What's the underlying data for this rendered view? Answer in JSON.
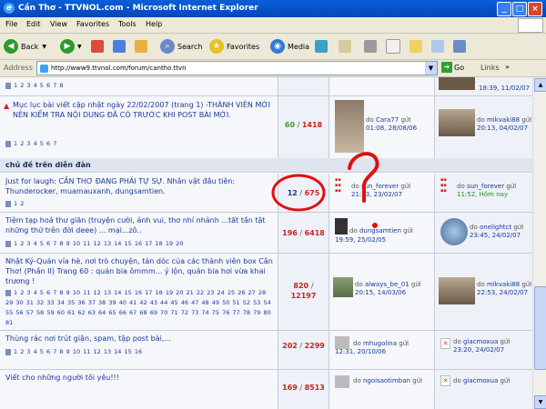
{
  "window": {
    "title": "Cần Thơ - TTVNOL.com - Microsoft Internet Explorer"
  },
  "menu": [
    "File",
    "Edit",
    "View",
    "Favorites",
    "Tools",
    "Help"
  ],
  "toolbar": {
    "back": "Back",
    "search": "Search",
    "favorites": "Favorites",
    "media": "Media"
  },
  "address": {
    "label": "Address",
    "url": "http://www9.ttvnol.com/forum/cantho.ttvn",
    "go": "Go",
    "links": "Links"
  },
  "rows_top": [
    {
      "pages": "1 2 3 4 5 6 7 8",
      "poster_time": "18:39, 11/02/07"
    },
    {
      "title": "Mục lục bài viết cập nhật ngày 22/02/2007 (trang 1) -THÀNH VIÊN MỚI NÊN KIỂM TRA NỘI DUNG ĐÃ CÓ TRƯỚC KHI POST BÀI MỚI.",
      "pages": "1 2 3 4 5 6 7",
      "replies": "60",
      "views": "1418",
      "first_by": "do",
      "first_user": "Cara77",
      "first_suffix": "gửi",
      "first_time": "01:08, 28/08/06",
      "last_by": "do",
      "last_user": "mikvaki88",
      "last_suffix": "gửi",
      "last_time": "20:13, 04/02/07"
    }
  ],
  "section": {
    "title": "chủ đề trên diễn đàn"
  },
  "rows": [
    {
      "title": "Just for laugh: CẦN THƠ ĐANG PHẢI TỰ SỰ. Nhân vật đầu tiên: Thunderocker, muamauxanh, dungsamtien.",
      "pages": "1 2",
      "replies": "12",
      "views": "675",
      "first_by": "do",
      "first_user": "sun_forever",
      "first_suffix": "gửi",
      "first_time": "21:53, 23/02/07",
      "last_by": "do",
      "last_user": "sun_forever",
      "last_suffix": "gửi",
      "last_time": "11:52, Hôm nay"
    },
    {
      "title": "Tiệm tạp hoá thư giãn (truyện cười, ảnh vui, thơ nhí nhảnh ...tất tần tật những thứ trên đời deee) ... mại...zô..",
      "pages": "1 2 3 4 5 6 7 8 9 10 11 12 13 14 15 16 17 18 19 20",
      "replies": "196",
      "views": "6418",
      "first_by": "do",
      "first_user": "dungsamtien",
      "first_suffix": "gửi",
      "first_time": "19:59, 25/02/05",
      "last_by": "do",
      "last_user": "onelightct",
      "last_suffix": "gửi",
      "last_time": "23:45, 24/02/07"
    },
    {
      "title": "Nhật Ký-Quán vỉa hè, nơi trò chuyện, tán dóc của các thành viên box Cần Thơ! (Phần II) Trang 60 : quán bia ômmm... ý lộn, quán bia hơi vừa khai trương !",
      "pages": "1 2 3 4 5 6 7 8 9 10 11 12 13 14 15 16 17 18 19 20 21 22 23 24 25 26 27 28 29 30 31 32 33 34 35 36 37 38 39 40 41 42 43 44 45 46 47 48 49 50 51 52 53 54 55 56 57 58 59 60 61 62 63 64 65 66 67 68 69 70 71 72 73 74 75 76 77 78 79 80 81",
      "replies": "820",
      "views": "12197",
      "first_by": "do",
      "first_user": "always_be_01",
      "first_suffix": "gửi",
      "first_time": "20:15, 14/03/06",
      "last_by": "do",
      "last_user": "mikvaki88",
      "last_suffix": "gửi",
      "last_time": "22:53, 24/02/07"
    },
    {
      "title": "Thùng rác nơi trút giận, spam, tập post bài,...",
      "pages": "1 2 3 4 5 6 7 8 9 10 11 12 13 14 15 16",
      "replies": "202",
      "views": "2299",
      "first_by": "do",
      "first_user": "mhugolina",
      "first_suffix": "gửi",
      "first_time": "12:31, 20/10/06",
      "last_by": "do",
      "last_user": "giacmoxua",
      "last_suffix": "gửi",
      "last_time": "23:20, 24/02/07"
    },
    {
      "title": "Viết cho những người tôi yêu!!!",
      "replies": "169",
      "views": "8513",
      "first_by": "do",
      "first_user": "ngoisaotimban",
      "first_suffix": "gửi",
      "last_by": "do",
      "last_user": "giacmoxua",
      "last_suffix": "gửi"
    }
  ]
}
